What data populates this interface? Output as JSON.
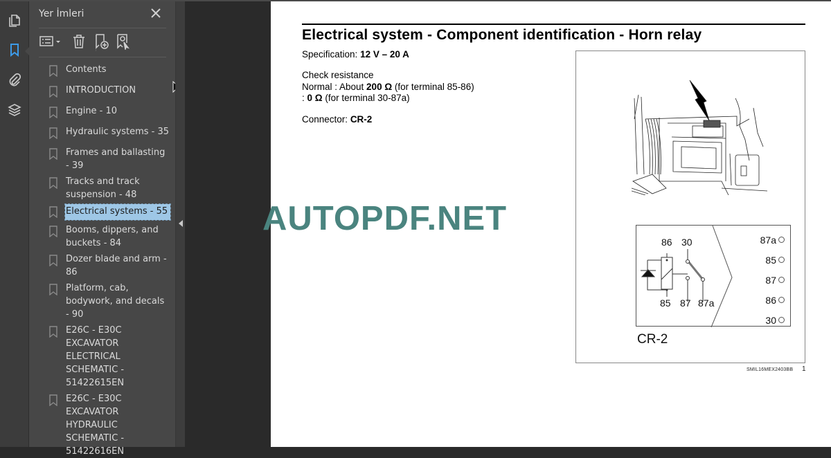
{
  "sidebar_rail": {
    "items": [
      {
        "name": "page-thumbnails",
        "icon": "pages-icon",
        "active": false
      },
      {
        "name": "bookmarks",
        "icon": "bookmark-icon",
        "active": true
      },
      {
        "name": "attachments",
        "icon": "paperclip-icon",
        "active": false
      },
      {
        "name": "layers",
        "icon": "layers-icon",
        "active": false
      }
    ],
    "accent": "#3d9be9"
  },
  "bookmarks_panel": {
    "title": "Yer İmleri",
    "close_icon": "close-icon",
    "toolbar": [
      {
        "name": "options-menu",
        "icon": "list-options-icon"
      },
      {
        "name": "delete-bookmark",
        "icon": "trash-icon"
      },
      {
        "name": "new-bookmark",
        "icon": "bookmark-add-icon"
      },
      {
        "name": "find-current-bookmark",
        "icon": "bookmark-find-icon"
      }
    ],
    "items": [
      {
        "label": "Contents",
        "selected": false
      },
      {
        "label": "INTRODUCTION",
        "selected": false
      },
      {
        "label": "Engine - 10",
        "selected": false
      },
      {
        "label": "Hydraulic systems - 35",
        "selected": false
      },
      {
        "label": "Frames and ballasting - 39",
        "selected": false
      },
      {
        "label": "Tracks and track suspension - 48",
        "selected": false
      },
      {
        "label": "Electrical systems - 55",
        "selected": true
      },
      {
        "label": "Booms, dippers, and buckets - 84",
        "selected": false
      },
      {
        "label": "Dozer blade and arm - 86",
        "selected": false
      },
      {
        "label": "Platform, cab, bodywork, and decals - 90",
        "selected": false
      },
      {
        "label": "E26C - E30C EXCAVATOR ELECTRICAL SCHEMATIC - 51422615EN",
        "selected": false
      },
      {
        "label": "E26C - E30C EXCAVATOR HYDRAULIC SCHEMATIC - 51422616EN",
        "selected": false
      }
    ],
    "selection_color": "#9ec7e6"
  },
  "document": {
    "title": "Electrical system - Component identification - Horn relay",
    "spec_label": "Specification:",
    "spec_value": "12 V – 20 A",
    "check_heading": "Check resistance",
    "normal_prefix": "Normal : About ",
    "normal_value": "200 Ω",
    "normal_suffix": " (for terminal 85-86)",
    "zero_prefix": ": ",
    "zero_value": "0 Ω",
    "zero_suffix": " (for terminal 30-87a)",
    "connector_label": "Connector:",
    "connector_value": "CR-2",
    "figure": {
      "relay_terminals_left": [
        "86",
        "30"
      ],
      "relay_terminals_bottom": [
        "85",
        "87",
        "87a"
      ],
      "connector_pins": [
        "87a",
        "85",
        "87",
        "86",
        "30"
      ],
      "caption": "CR-2"
    },
    "footer_code": "SMIL16MEX2403BB",
    "page_number": "1"
  },
  "watermark": "AUTOPDF.NET"
}
